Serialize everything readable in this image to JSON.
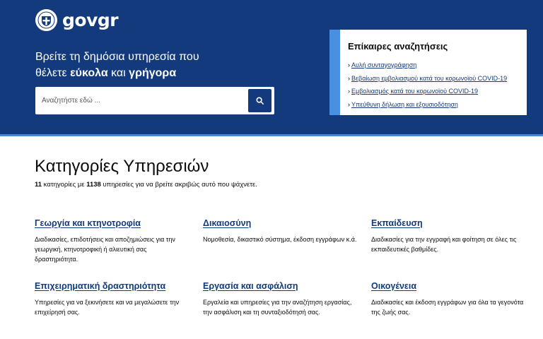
{
  "header": {
    "logo_prefix": "gov",
    "logo_suffix": "gr",
    "tagline_line1": "Βρείτε τη δημόσια υπηρεσία που",
    "tagline_line2_prefix": "θέλετε ",
    "tagline_bold1": "εύκολα",
    "tagline_mid": " και ",
    "tagline_bold2": "γρήγορα",
    "search_placeholder": "Αναζητήστε εδώ ...",
    "colors": {
      "primary": "#133a7c",
      "accent": "#4a90e2"
    }
  },
  "trending": {
    "title": "Επίκαιρες αναζητήσεις",
    "items": [
      {
        "label": "Αυλή συνταγογράφηση"
      },
      {
        "label": "Βεβαίωση εμβολιασμού κατά του κορωνοϊού COVID-19"
      },
      {
        "label": "Εμβολιασμός κατά του κορωνοϊού COVID-19"
      },
      {
        "label": "Υπεύθυνη δήλωση και εξουσιοδότηση"
      }
    ]
  },
  "categories": {
    "title": "Κατηγορίες Υπηρεσιών",
    "count_categories": "11",
    "count_text1": " κατηγορίες με ",
    "count_services": "1138",
    "count_text2": " υπηρεσίες για να βρείτε ακριβώς αυτό που ψάχνετε.",
    "items": [
      {
        "title": "Γεωργία και κτηνοτροφία",
        "description": "Διαδικασίες, επιδοτήσεις και αποζημιώσεις για την γεωργική, κτηνοτροφική ή αλιευτική σας δραστηριότητα."
      },
      {
        "title": "Δικαιοσύνη",
        "description": "Νομοθεσία, δικαστικό σύστημα, έκδοση εγγράφων κ.ά."
      },
      {
        "title": "Εκπαίδευση",
        "description": "Διαδικασίες για την εγγραφή και φοίτηση σε όλες τις εκπαιδευτικές βαθμίδες."
      },
      {
        "title": "Επιχειρηματική δραστηριότητα",
        "description": "Υπηρεσίες για να ξεκινήσετε και να μεγαλώσετε την επιχείρησή σας."
      },
      {
        "title": "Εργασία και ασφάλιση",
        "description": "Εργαλεία και υπηρεσίες για την αναζήτηση εργασίας, την ασφάλιση και τη συνταξιοδότησή σας."
      },
      {
        "title": "Οικογένεια",
        "description": "Διαδικασίες και έκδοση εγγράφων για όλα τα γεγονότα της ζωής σας."
      }
    ]
  }
}
